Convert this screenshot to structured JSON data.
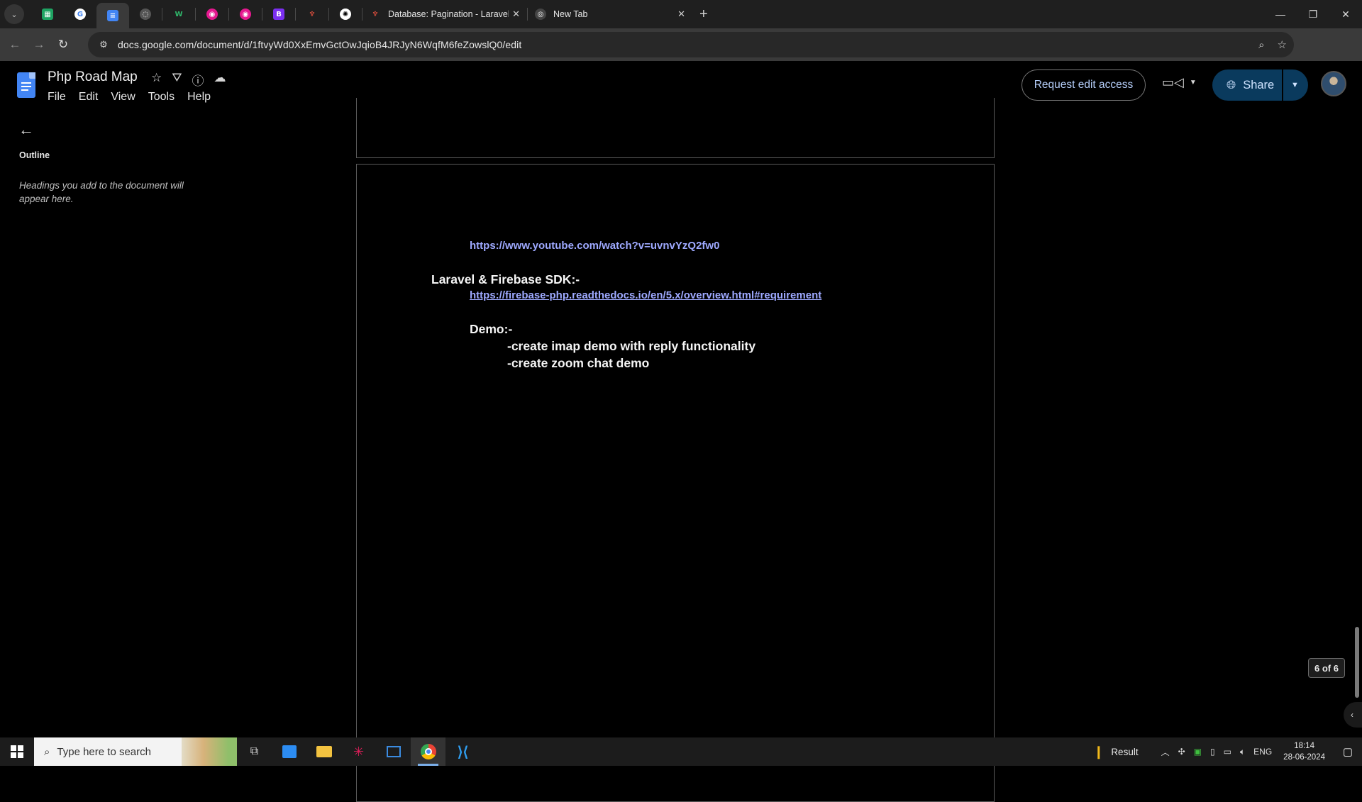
{
  "browser": {
    "tabs": [
      {
        "title": "Database: Pagination - Laravel"
      },
      {
        "title": "New Tab"
      }
    ],
    "url": "docs.google.com/document/d/1ftvyWd0XxEmvGctOwJqioB4JRJyN6WqfM6feZowslQ0/edit"
  },
  "docs": {
    "title": "Php Road Map",
    "menu": [
      "File",
      "Edit",
      "View",
      "Tools",
      "Help"
    ],
    "request_edit": "Request edit access",
    "share": "Share"
  },
  "outline": {
    "title": "Outline",
    "hint": "Headings you add to the document will appear here."
  },
  "document": {
    "link1": "https://www.youtube.com/watch?v=uvnvYzQ2fw0",
    "heading": "Laravel & Firebase SDK:-",
    "link2": "https://firebase-php.readthedocs.io/en/5.x/overview.html#requirement",
    "demo_label": "Demo:-",
    "items": [
      "-create imap demo with reply functionality",
      "-create zoom chat demo"
    ]
  },
  "page_indicator": "6 of 6",
  "taskbar": {
    "search_placeholder": "Type here to search",
    "weather": "Result",
    "lang": "ENG",
    "time": "18:14",
    "date": "28-06-2024"
  },
  "colors": {
    "link": "#9ea9ff",
    "share_bg": "#0a3a5d",
    "docs_blue": "#4285f4"
  }
}
